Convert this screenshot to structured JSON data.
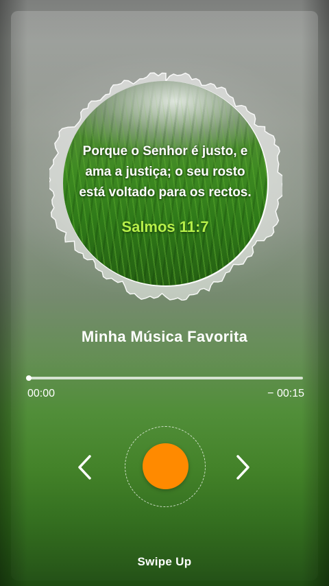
{
  "album_art": {
    "verse_lines": [
      "Porque o Senhor é justo, e",
      "ama a justiça; o seu rosto",
      "está voltado para os rectos."
    ],
    "reference": "Salmos 11:7"
  },
  "player": {
    "title": "Minha Música Favorita",
    "elapsed": "00:00",
    "remaining": "− 00:15",
    "progress_fraction": 0.0,
    "prev_icon": "chevron-left-icon",
    "next_icon": "chevron-right-icon",
    "play_button_color": "#ff8a00"
  },
  "footer": {
    "swipe_label": "Swipe Up"
  },
  "colors": {
    "accent": "#ff8a00",
    "reference_text": "#b6f049",
    "text": "#ffffff"
  }
}
